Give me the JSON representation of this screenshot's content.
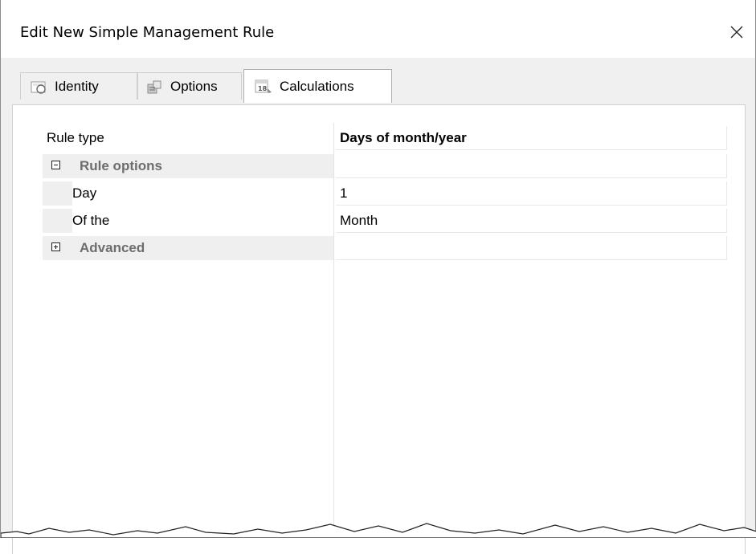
{
  "window": {
    "title": "Edit New Simple Management Rule",
    "close_icon": "close-icon"
  },
  "tabs": [
    {
      "label": "Identity",
      "icon": "identity-icon",
      "active": false
    },
    {
      "label": "Options",
      "icon": "options-icon",
      "active": false
    },
    {
      "label": "Calculations",
      "icon": "calendar-icon",
      "active": true
    }
  ],
  "property_grid": {
    "rows": [
      {
        "kind": "property",
        "name": "Rule type",
        "value": "Days of month/year",
        "value_bold": true
      },
      {
        "kind": "category",
        "name": "Rule options",
        "expanded": true
      },
      {
        "kind": "property",
        "name": "Day",
        "value": "1"
      },
      {
        "kind": "property",
        "name": "Of the",
        "value": "Month"
      },
      {
        "kind": "category",
        "name": "Advanced",
        "expanded": false
      }
    ]
  },
  "colors": {
    "category_background": "#efefef",
    "category_text": "#6d6d6d",
    "panel_background": "#f0f0f0"
  }
}
